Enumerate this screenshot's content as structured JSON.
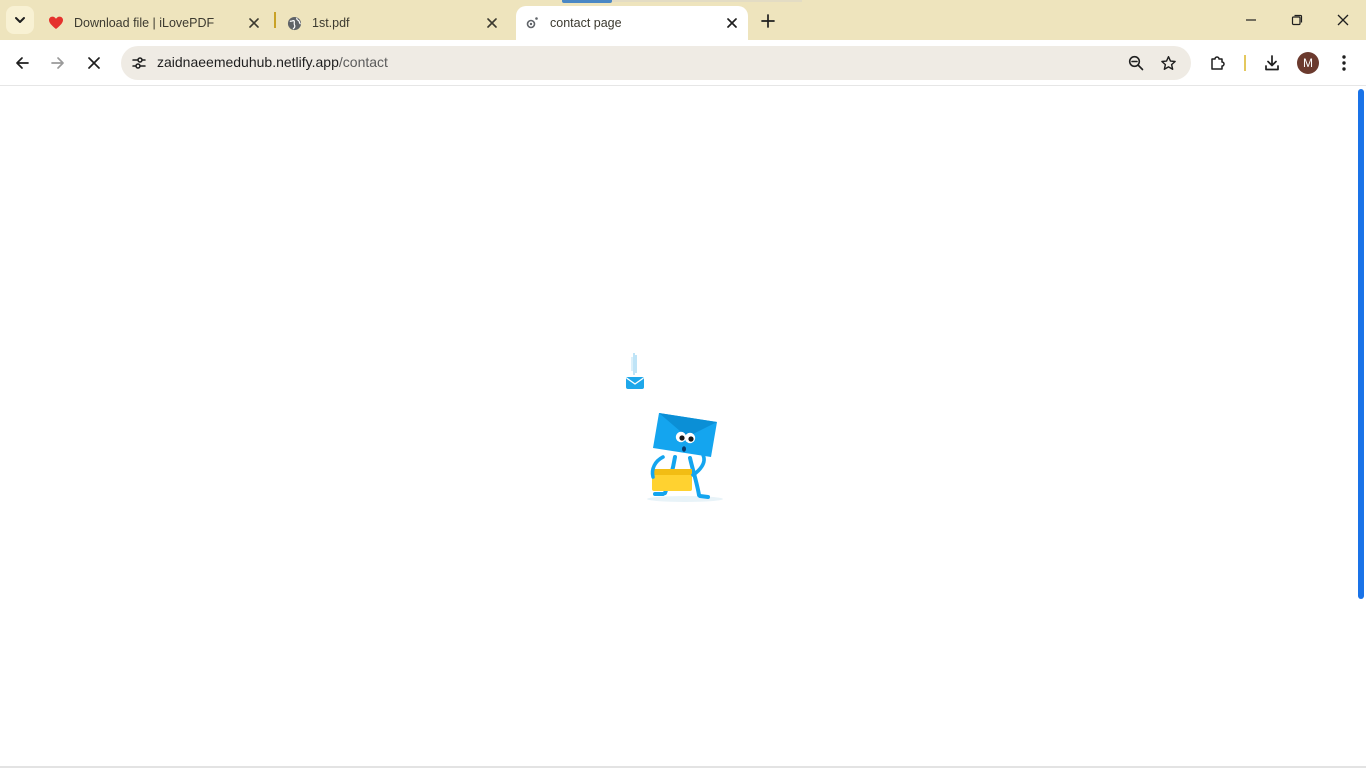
{
  "browser": {
    "tabs": [
      {
        "title": "Download file | iLovePDF",
        "favicon": "heart-icon",
        "active": false
      },
      {
        "title": "1st.pdf",
        "favicon": "globe-icon",
        "active": false
      },
      {
        "title": "contact page",
        "favicon": "loading-icon",
        "active": true
      }
    ],
    "omnibox": {
      "domain": "zaidnaeemeduhub.netlify.app",
      "path": "/contact"
    },
    "profile_initial": "M",
    "colors": {
      "tabstrip": "#eee4bd",
      "omnibox": "#efebe4",
      "avatar": "#6b3a2e",
      "scroll_thumb": "#1a73e8",
      "ilovepdf_heart": "#e5322d"
    }
  },
  "page": {
    "state": "loading",
    "illustration": "mail-carrier-loading-animation"
  }
}
